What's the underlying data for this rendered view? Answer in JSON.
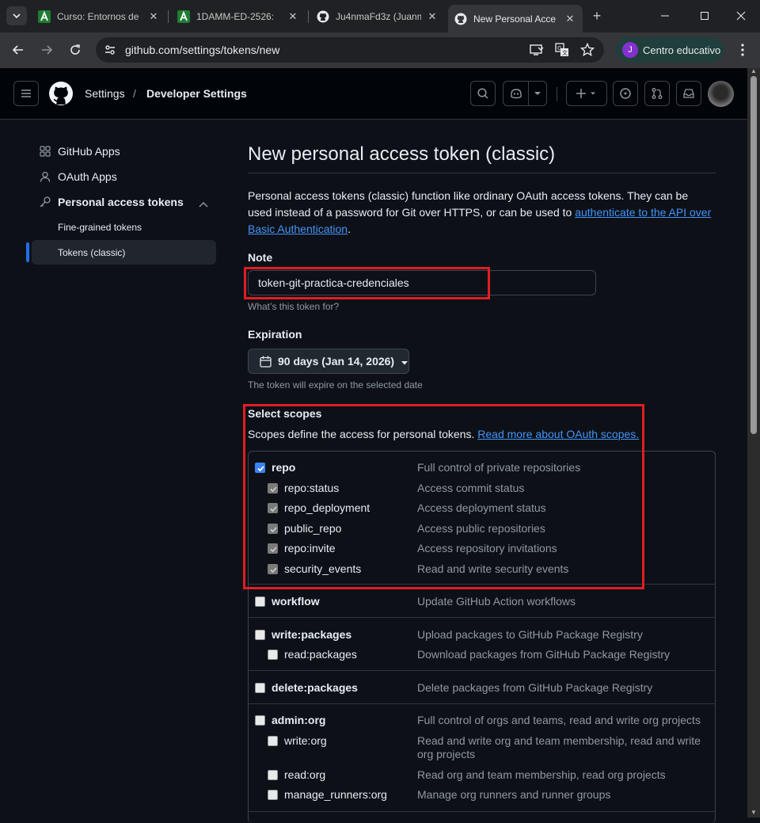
{
  "browser": {
    "tabs": [
      {
        "title": "Curso: Entornos de",
        "icon": "moodle-a-icon"
      },
      {
        "title": "1DAMM-ED-2526: ",
        "icon": "moodle-a-icon"
      },
      {
        "title": "Ju4nmaFd3z (Juanm",
        "icon": "github-icon"
      },
      {
        "title": "New Personal Acce",
        "icon": "github-icon"
      }
    ],
    "url": "github.com/settings/tokens/new",
    "profile_initial": "J",
    "profile_label": "Centro educativo"
  },
  "header": {
    "crumb_settings": "Settings",
    "crumb_sep": "/",
    "crumb_current": "Developer Settings"
  },
  "sidebar": {
    "github_apps": "GitHub Apps",
    "oauth_apps": "OAuth Apps",
    "personal_tokens": "Personal access tokens",
    "fine_grained": "Fine-grained tokens",
    "tokens_classic": "Tokens (classic)"
  },
  "main": {
    "title": "New personal access token (classic)",
    "desc_text": "Personal access tokens (classic) function like ordinary OAuth access tokens. They can be used instead of a password for Git over HTTPS, or can be used to ",
    "desc_link": "authenticate to the API over Basic Authentication",
    "desc_end": ".",
    "note_label": "Note",
    "note_value": "token-git-practica-credenciales",
    "note_hint": "What’s this token for?",
    "expiration_label": "Expiration",
    "expiration_value": "90 days (Jan 14, 2026)",
    "expiration_hint": "The token will expire on the selected date",
    "scopes_label": "Select scopes",
    "scopes_text": "Scopes define the access for personal tokens. ",
    "scopes_link": "Read more about OAuth scopes."
  },
  "scopes": {
    "repo": {
      "name": "repo",
      "desc": "Full control of private repositories"
    },
    "repo_status": {
      "name": "repo:status",
      "desc": "Access commit status"
    },
    "repo_deployment": {
      "name": "repo_deployment",
      "desc": "Access deployment status"
    },
    "public_repo": {
      "name": "public_repo",
      "desc": "Access public repositories"
    },
    "repo_invite": {
      "name": "repo:invite",
      "desc": "Access repository invitations"
    },
    "security_events": {
      "name": "security_events",
      "desc": "Read and write security events"
    },
    "workflow": {
      "name": "workflow",
      "desc": "Update GitHub Action workflows"
    },
    "write_packages": {
      "name": "write:packages",
      "desc": "Upload packages to GitHub Package Registry"
    },
    "read_packages": {
      "name": "read:packages",
      "desc": "Download packages from GitHub Package Registry"
    },
    "delete_packages": {
      "name": "delete:packages",
      "desc": "Delete packages from GitHub Package Registry"
    },
    "admin_org": {
      "name": "admin:org",
      "desc": "Full control of orgs and teams, read and write org projects"
    },
    "write_org": {
      "name": "write:org",
      "desc": "Read and write org and team membership, read and write org projects"
    },
    "read_org": {
      "name": "read:org",
      "desc": "Read org and team membership, read org projects"
    },
    "manage_runners_org": {
      "name": "manage_runners:org",
      "desc": "Manage org runners and runner groups"
    }
  },
  "colors": {
    "accent": "#4493f8",
    "highlight": "#e11d24",
    "background": "#0d1117"
  }
}
